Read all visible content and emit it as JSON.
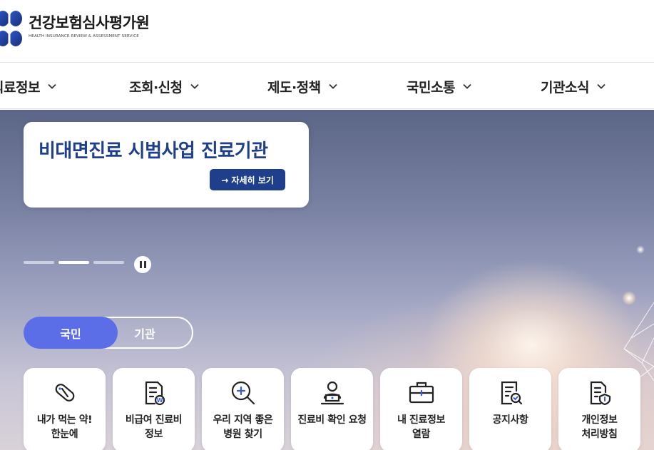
{
  "header": {
    "logo_ko": "건강보험심사평가원",
    "logo_en": "HEALTH INSURANCE REVIEW & ASSESSMENT SERVICE"
  },
  "nav": {
    "items": [
      {
        "label": "의료정보"
      },
      {
        "label": "조회·신청"
      },
      {
        "label": "제도·정책"
      },
      {
        "label": "국민소통"
      },
      {
        "label": "기관소식"
      }
    ]
  },
  "hero": {
    "slide_title": "비대면진료 시범사업 진료기관",
    "more_label": "→ 자세히 보기",
    "slide_count": 3,
    "active_slide": 2
  },
  "toggle": {
    "active": "국민",
    "inactive": "기관"
  },
  "quick_menu": [
    {
      "label": "내가 먹는 약!\n한눈에",
      "icon": "pill-icon"
    },
    {
      "label": "비급여 진료비\n정보",
      "icon": "document-won-icon"
    },
    {
      "label": "우리 지역 좋은\n병원 찾기",
      "icon": "search-plus-icon"
    },
    {
      "label": "진료비 확인 요청",
      "icon": "person-laptop-icon"
    },
    {
      "label": "내 진료정보\n열람",
      "icon": "briefcase-icon"
    },
    {
      "label": "공지사항",
      "icon": "document-search-icon"
    },
    {
      "label": "개인정보\n처리방침",
      "icon": "document-shield-icon"
    }
  ],
  "colors": {
    "brand_navy": "#1f3f8c",
    "toggle_active": "#5b6ee8"
  }
}
